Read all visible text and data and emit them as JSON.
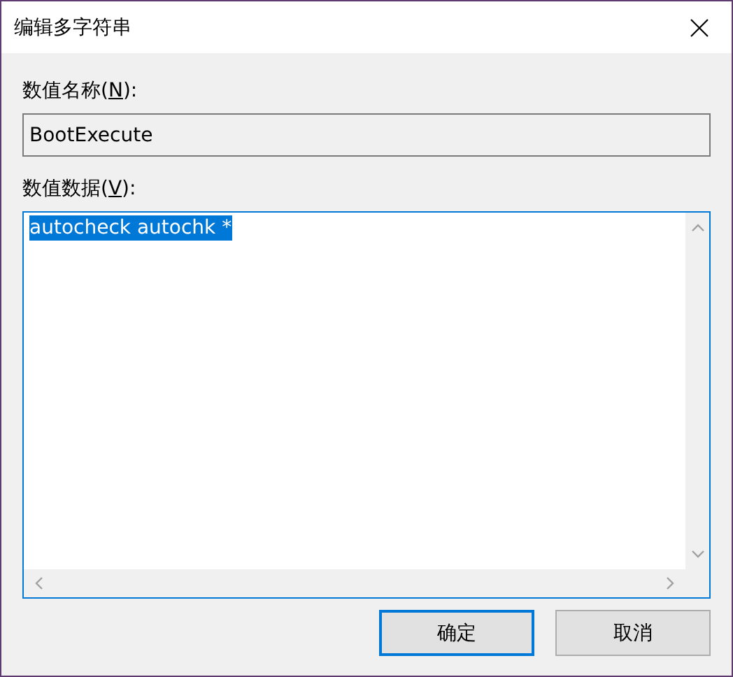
{
  "window": {
    "title": "编辑多字符串"
  },
  "name_field": {
    "label": {
      "before": "数值名称(",
      "access_key": "N",
      "after": "):"
    },
    "value": "BootExecute",
    "disabled": true
  },
  "data_field": {
    "label": {
      "before": "数值数据(",
      "access_key": "V",
      "after": "):"
    },
    "lines": [
      {
        "text": "autocheck autochk *",
        "selected": true
      }
    ],
    "focused": true
  },
  "buttons": [
    {
      "label": "确定",
      "default": true
    },
    {
      "label": "取消",
      "default": false
    }
  ]
}
